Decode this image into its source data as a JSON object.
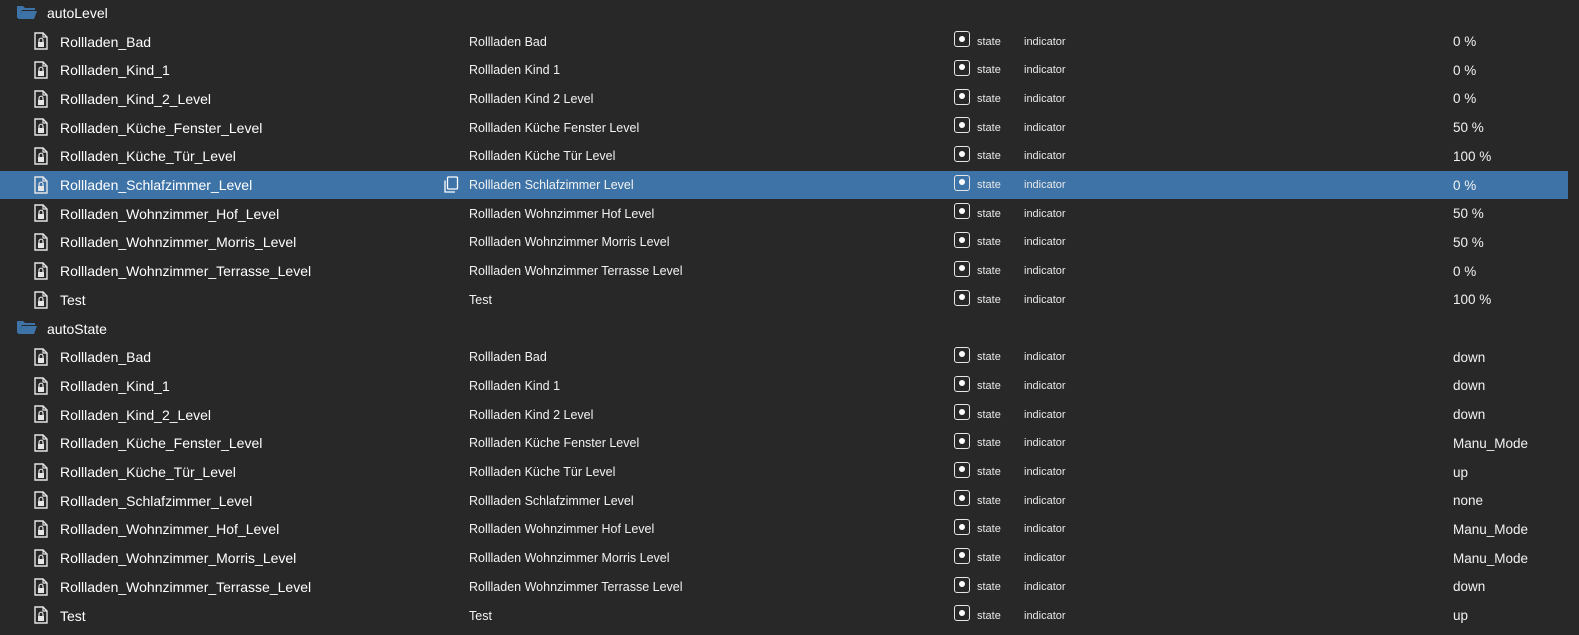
{
  "colors": {
    "background": "#282828",
    "selected_row": "#3d73a6",
    "folder_icon": "#3d73a6"
  },
  "groups": [
    {
      "folder": "autoLevel",
      "folder_icon": "folder-open-icon",
      "rows": [
        {
          "id": "Rollladen_Bad",
          "name": "Rollladen Bad",
          "type": "state",
          "role": "indicator",
          "value": "0 %"
        },
        {
          "id": "Rollladen_Kind_1",
          "name": "Rollladen Kind 1",
          "type": "state",
          "role": "indicator",
          "value": "0 %"
        },
        {
          "id": "Rollladen_Kind_2_Level",
          "name": "Rollladen Kind 2 Level",
          "type": "state",
          "role": "indicator",
          "value": "0 %"
        },
        {
          "id": "Rollladen_Küche_Fenster_Level",
          "name": "Rollladen Küche Fenster Level",
          "type": "state",
          "role": "indicator",
          "value": "50 %"
        },
        {
          "id": "Rollladen_Küche_Tür_Level",
          "name": "Rollladen Küche Tür Level",
          "type": "state",
          "role": "indicator",
          "value": "100 %"
        },
        {
          "id": "Rollladen_Schlafzimmer_Level",
          "name": "Rollladen Schlafzimmer Level",
          "type": "state",
          "role": "indicator",
          "value": "0 %",
          "selected": true
        },
        {
          "id": "Rollladen_Wohnzimmer_Hof_Level",
          "name": "Rollladen Wohnzimmer Hof Level",
          "type": "state",
          "role": "indicator",
          "value": "50 %"
        },
        {
          "id": "Rollladen_Wohnzimmer_Morris_Level",
          "name": "Rollladen Wohnzimmer Morris Level",
          "type": "state",
          "role": "indicator",
          "value": "50 %"
        },
        {
          "id": "Rollladen_Wohnzimmer_Terrasse_Level",
          "name": "Rollladen Wohnzimmer Terrasse Level",
          "type": "state",
          "role": "indicator",
          "value": "0 %"
        },
        {
          "id": "Test",
          "name": "Test",
          "type": "state",
          "role": "indicator",
          "value": "100 %"
        }
      ]
    },
    {
      "folder": "autoState",
      "folder_icon": "folder-open-icon",
      "rows": [
        {
          "id": "Rollladen_Bad",
          "name": "Rollladen Bad",
          "type": "state",
          "role": "indicator",
          "value": "down"
        },
        {
          "id": "Rollladen_Kind_1",
          "name": "Rollladen Kind 1",
          "type": "state",
          "role": "indicator",
          "value": "down"
        },
        {
          "id": "Rollladen_Kind_2_Level",
          "name": "Rollladen Kind 2 Level",
          "type": "state",
          "role": "indicator",
          "value": "down"
        },
        {
          "id": "Rollladen_Küche_Fenster_Level",
          "name": "Rollladen Küche Fenster Level",
          "type": "state",
          "role": "indicator",
          "value": "Manu_Mode"
        },
        {
          "id": "Rollladen_Küche_Tür_Level",
          "name": "Rollladen Küche Tür Level",
          "type": "state",
          "role": "indicator",
          "value": "up"
        },
        {
          "id": "Rollladen_Schlafzimmer_Level",
          "name": "Rollladen Schlafzimmer Level",
          "type": "state",
          "role": "indicator",
          "value": "none"
        },
        {
          "id": "Rollladen_Wohnzimmer_Hof_Level",
          "name": "Rollladen Wohnzimmer Hof Level",
          "type": "state",
          "role": "indicator",
          "value": "Manu_Mode"
        },
        {
          "id": "Rollladen_Wohnzimmer_Morris_Level",
          "name": "Rollladen Wohnzimmer Morris Level",
          "type": "state",
          "role": "indicator",
          "value": "Manu_Mode"
        },
        {
          "id": "Rollladen_Wohnzimmer_Terrasse_Level",
          "name": "Rollladen Wohnzimmer Terrasse Level",
          "type": "state",
          "role": "indicator",
          "value": "down"
        },
        {
          "id": "Test",
          "name": "Test",
          "type": "state",
          "role": "indicator",
          "value": "up"
        }
      ]
    }
  ]
}
